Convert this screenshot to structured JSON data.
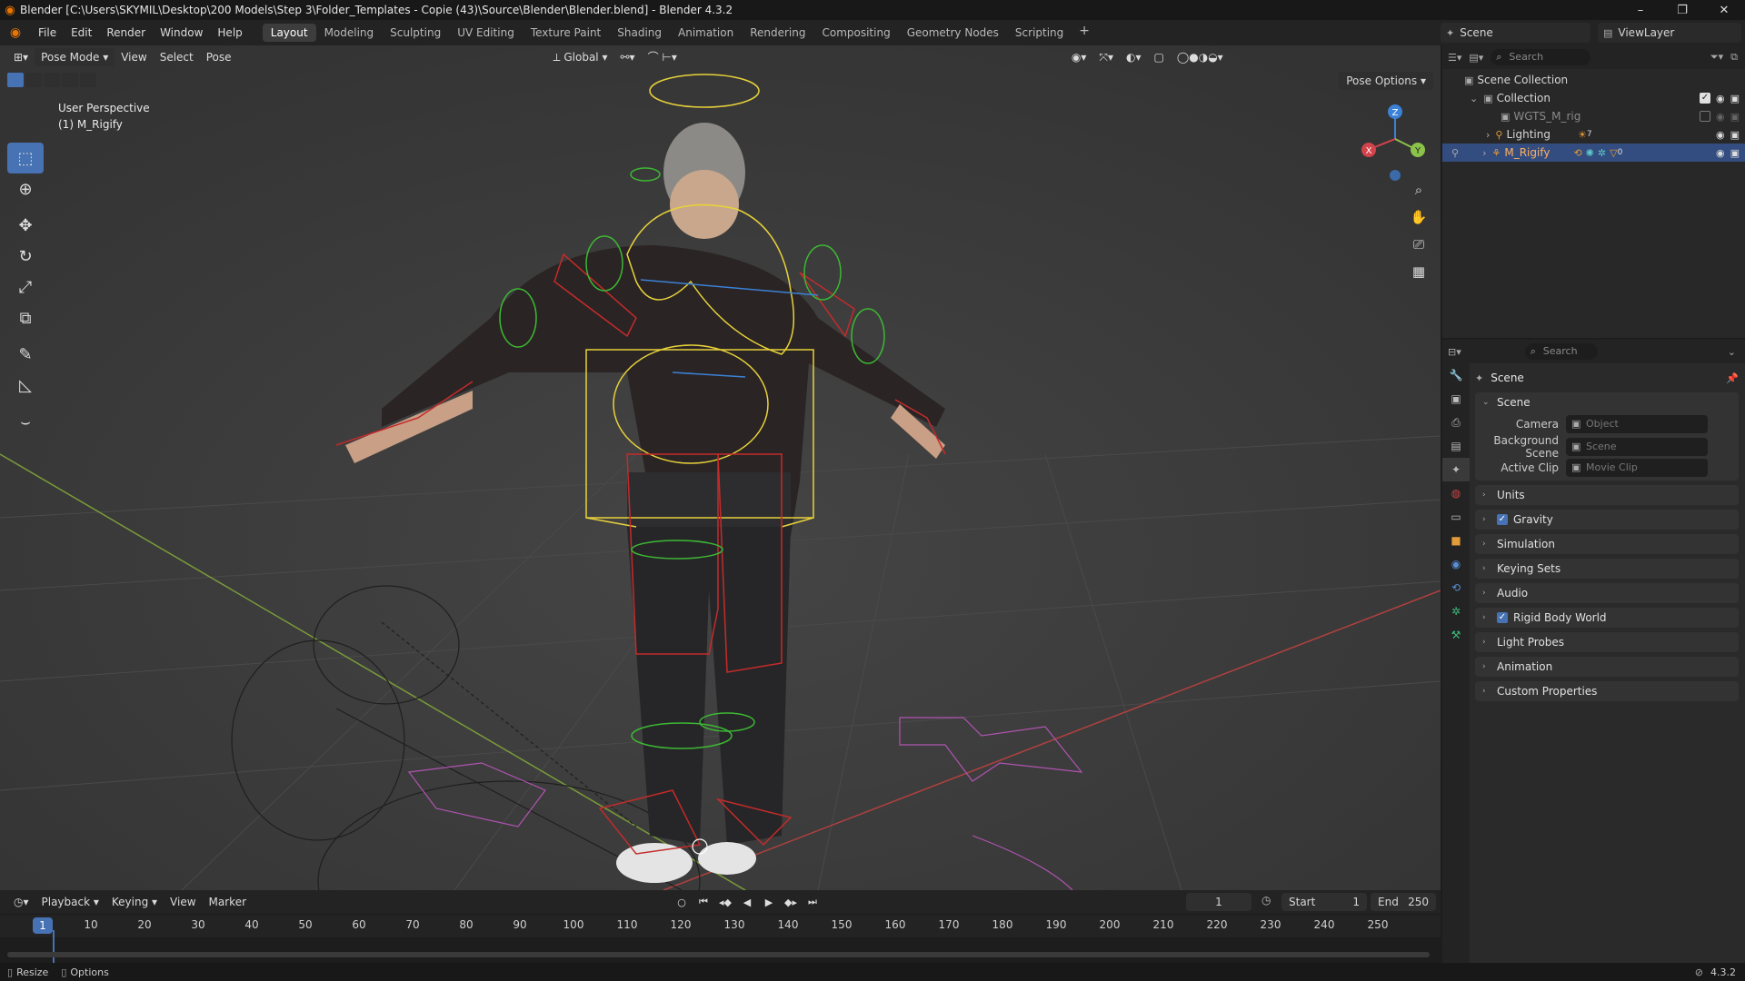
{
  "window": {
    "title": "Blender [C:\\Users\\SKYMIL\\Desktop\\200 Models\\Step 3\\Folder_Templates - Copie (43)\\Source\\Blender\\Blender.blend] - Blender 4.3.2",
    "minimize": "–",
    "maximize": "❐",
    "close": "✕"
  },
  "menu": [
    "File",
    "Edit",
    "Render",
    "Window",
    "Help"
  ],
  "workspaces": [
    "Layout",
    "Modeling",
    "Sculpting",
    "UV Editing",
    "Texture Paint",
    "Shading",
    "Animation",
    "Rendering",
    "Compositing",
    "Geometry Nodes",
    "Scripting"
  ],
  "active_workspace": "Layout",
  "scene_name": "Scene",
  "view_layer": "ViewLayer",
  "viewport": {
    "mode": "Pose Mode",
    "menus": [
      "View",
      "Select",
      "Pose"
    ],
    "orientation": "Global",
    "pose_options": "Pose Options",
    "info_line1": "User Perspective",
    "info_line2": "(1) M_Rigify",
    "gizmo": {
      "x": "X",
      "y": "Y",
      "z": "Z"
    }
  },
  "timeline": {
    "menus": [
      "Playback",
      "Keying",
      "View",
      "Marker"
    ],
    "current_frame": "1",
    "start_label": "Start",
    "start": "1",
    "end_label": "End",
    "end": "250",
    "ticks": [
      "10",
      "20",
      "30",
      "40",
      "50",
      "60",
      "70",
      "80",
      "90",
      "100",
      "110",
      "120",
      "130",
      "140",
      "150",
      "160",
      "170",
      "180",
      "190",
      "200",
      "210",
      "220",
      "230",
      "240",
      "250"
    ],
    "marker": "1"
  },
  "outliner": {
    "search_placeholder": "Search",
    "rows": [
      {
        "name": "Scene Collection"
      },
      {
        "name": "Collection"
      },
      {
        "name": "WGTS_M_rig"
      },
      {
        "name": "Lighting",
        "badge": "7"
      },
      {
        "name": "M_Rigify",
        "badge": "0"
      }
    ]
  },
  "properties": {
    "search_placeholder": "Search",
    "context_title": "Scene",
    "panel_title": "Scene",
    "fields": [
      {
        "label": "Camera",
        "placeholder": "Object"
      },
      {
        "label": "Background Scene",
        "placeholder": "Scene"
      },
      {
        "label": "Active Clip",
        "placeholder": "Movie Clip"
      }
    ],
    "sections": [
      {
        "label": "Units",
        "checkbox": false
      },
      {
        "label": "Gravity",
        "checkbox": true
      },
      {
        "label": "Simulation",
        "checkbox": false
      },
      {
        "label": "Keying Sets",
        "checkbox": false
      },
      {
        "label": "Audio",
        "checkbox": false
      },
      {
        "label": "Rigid Body World",
        "checkbox": true
      },
      {
        "label": "Light Probes",
        "checkbox": false
      },
      {
        "label": "Animation",
        "checkbox": false
      },
      {
        "label": "Custom Properties",
        "checkbox": false
      }
    ]
  },
  "statusbar": {
    "resize": "Resize",
    "options": "Options",
    "version": "4.3.2"
  },
  "colors": {
    "accent": "#4772b3",
    "bone_yellow": "#e8d23a",
    "bone_red": "#c42b2b",
    "bone_green": "#3db834",
    "axis_x": "#d3434b",
    "axis_y": "#8bc34a",
    "axis_z": "#3b82d6"
  }
}
